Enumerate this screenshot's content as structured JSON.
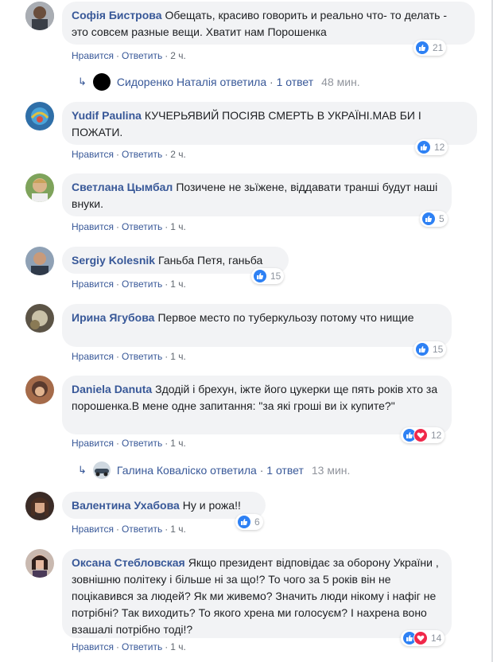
{
  "comments": [
    {
      "author": "Софія Бистрова",
      "text": "Обещать, красиво говорить и реально что- то делать - это совсем разные вещи. Хватит нам Порошенка",
      "like": "Нравится",
      "reply": "Ответить",
      "time": "2 ч.",
      "reactions": "21",
      "avatar_color": "#8a8f99"
    },
    {
      "author": "Yudif Paulina",
      "text": "КУЧЕРЬЯВИЙ ПОСІЯВ СМЕРТЬ В УКРАЇНІ.МАВ БИ І ПОЖАТИ.",
      "like": "Нравится",
      "reply": "Ответить",
      "time": "2 ч.",
      "reactions": "12",
      "avatar_color": "#3d7fb5"
    },
    {
      "author": "Светлана Цымбал",
      "text": "Позичене не зьїжене, віддавати транші будут наші внуки.",
      "like": "Нравится",
      "reply": "Ответить",
      "time": "1 ч.",
      "reactions": "5",
      "avatar_color": "#b08a5a"
    },
    {
      "author": "Sergiy Kolesnik",
      "text": "Ганьба Петя, ганьба",
      "like": "Нравится",
      "reply": "Ответить",
      "time": "1 ч.",
      "reactions": "15",
      "avatar_color": "#6b7a8f"
    },
    {
      "author": "Ирина Ягубова",
      "text": "Первое место по туберкульозу потому что нищие",
      "like": "Нравится",
      "reply": "Ответить",
      "time": "1 ч.",
      "reactions": "15",
      "avatar_color": "#7a6a55"
    },
    {
      "author": "Daniela Danuta",
      "text": "Здодій і брехун, іжте його цукерки ще пять років хто за порошенка.В мене одне запитання: \"за які гроші ви іх купите?\"",
      "like": "Нравится",
      "reply": "Ответить",
      "time": "1 ч.",
      "reactions": "12",
      "avatar_color": "#9c6b4e"
    },
    {
      "author": "Валентина Ухабова",
      "text": "Ну и рожа!!",
      "like": "Нравится",
      "reply": "Ответить",
      "time": "1 ч.",
      "reactions": "6",
      "avatar_color": "#4e3b34"
    },
    {
      "author": "Оксана Стебловская",
      "text": "Якщо президент відповідає за оборону України , зовнішню політеку і більше ні за що!? То чого за 5 років він не поцікавився за людей? Як ми живемо? Значить люди нікому і нафіг не потрібні? Так виходить? То якого хрена ми голосуєм? І нахрена воно взашалі потрібно тоді!?",
      "like": "Нравится",
      "reply": "Ответить",
      "time": "1 ч.",
      "reactions": "14",
      "avatar_color": "#5a4a48"
    }
  ],
  "replies": [
    {
      "name": "Сидоренко Наталія",
      "action": "ответила",
      "count": "1 ответ",
      "time": "48 мин."
    },
    {
      "name": "Галина Коваліско",
      "action": "ответила",
      "count": "1 ответ",
      "time": "13 мин."
    }
  ],
  "colors": {
    "link": "#385898",
    "bubble": "#f2f3f5",
    "like": "#2e81f4",
    "love": "#f0284a"
  }
}
